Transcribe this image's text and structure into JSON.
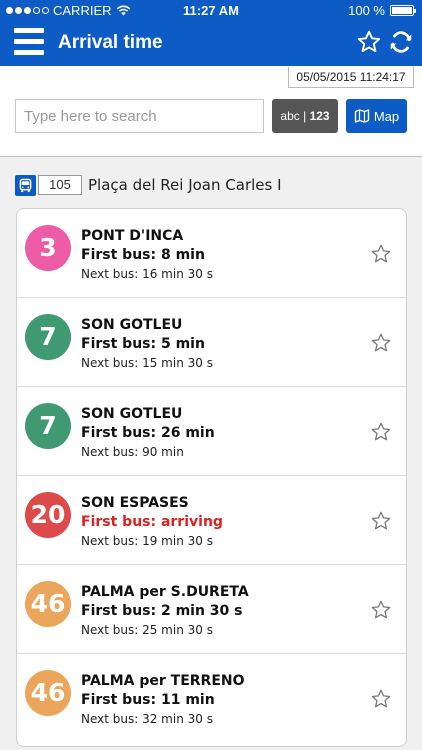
{
  "status_bar": {
    "carrier": "CARRIER",
    "time": "11:27 AM",
    "battery": "100 %"
  },
  "header": {
    "title": "Arrival time",
    "menu_icon": "hamburger-menu-icon",
    "favorite_icon": "star-outline-icon",
    "refresh_icon": "refresh-icon"
  },
  "timestamp": "05/05/2015 11:24:17",
  "search": {
    "placeholder": "Type here to search",
    "value": ""
  },
  "keyboard_toggle": {
    "label_abc": "abc",
    "separator": "|",
    "label_123": "123"
  },
  "map_button": {
    "label": "Map",
    "icon": "map-icon"
  },
  "stop": {
    "icon": "bus-icon",
    "code": "105",
    "name": "Plaça del Rei Joan Carles I"
  },
  "colors": {
    "primary": "#0d5bc5",
    "arriving": "#e01f1f"
  },
  "arrivals": [
    {
      "line": "3",
      "color": "#ee5ba6",
      "destination": "PONT D'INCA",
      "first_bus": "First bus: 8 min",
      "next_bus": "Next bus: 16 min 30 s",
      "arriving": false
    },
    {
      "line": "7",
      "color": "#3f9a72",
      "destination": "SON GOTLEU",
      "first_bus": "First bus: 5 min",
      "next_bus": "Next bus: 15 min 30 s",
      "arriving": false
    },
    {
      "line": "7",
      "color": "#3f9a72",
      "destination": "SON GOTLEU",
      "first_bus": "First bus: 26 min",
      "next_bus": "Next bus: 90 min",
      "arriving": false
    },
    {
      "line": "20",
      "color": "#dd4a4a",
      "destination": "SON ESPASES",
      "first_bus": "First bus: arriving",
      "next_bus": "Next bus: 19 min 30 s",
      "arriving": true
    },
    {
      "line": "46",
      "color": "#eba65c",
      "destination": "PALMA per S.DURETA",
      "first_bus": "First bus: 2 min 30 s",
      "next_bus": "Next bus: 25 min 30 s",
      "arriving": false
    },
    {
      "line": "46",
      "color": "#eba65c",
      "destination": "PALMA per TERRENO",
      "first_bus": "First bus: 11 min",
      "next_bus": "Next bus: 32 min 30 s",
      "arriving": false
    }
  ]
}
